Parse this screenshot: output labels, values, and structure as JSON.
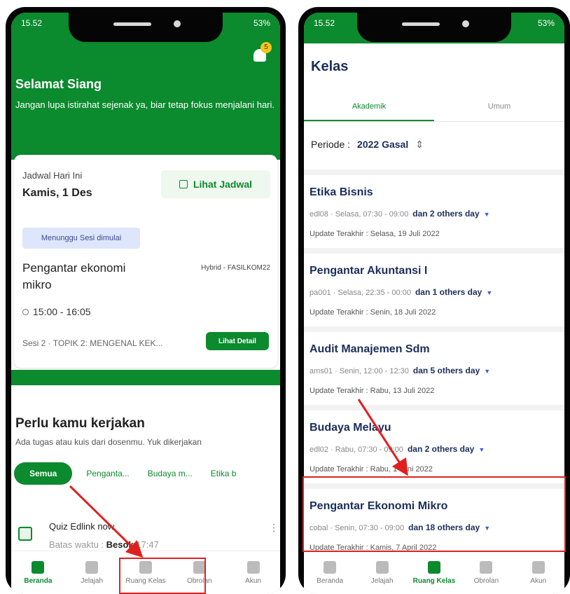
{
  "left": {
    "status": {
      "time": "15.52",
      "battery": "53%"
    },
    "notif_count": "5",
    "greeting": {
      "title": "Selamat Siang",
      "subtitle": "Jangan lupa istirahat sejenak ya, biar tetap fokus menjalani hari."
    },
    "schedule": {
      "label": "Jadwal Hari Ini",
      "date": "Kamis, 1 Des",
      "view_button": "Lihat Jadwal",
      "status_badge": "Menunggu Sesi dimulai",
      "course": "Pengantar ekonomi mikro",
      "mode": "Hybrid - FASILKOM22",
      "time": "15:00 - 16:05",
      "session": "Sesi 2 · TOPIK 2: MENGENAL KEK...",
      "detail_button": "Lihat Detail"
    },
    "todo": {
      "title": "Perlu kamu kerjakan",
      "subtitle": "Ada tugas atau kuis dari dosenmu. Yuk dikerjakan",
      "chips": [
        "Semua",
        "Penganta...",
        "Budaya m...",
        "Etika b"
      ],
      "quiz_title": "Quiz Edlink now",
      "deadline_label": "Batas waktu :",
      "deadline_day": "Besok",
      "deadline_time": "17:47"
    },
    "nav": [
      "Beranda",
      "Jelajah",
      "Ruang Kelas",
      "Obrolan",
      "Akun"
    ]
  },
  "right": {
    "status": {
      "time": "15.52",
      "battery": "53%"
    },
    "title": "Kelas",
    "tabs": [
      "Akademik",
      "Umum"
    ],
    "periode_label": "Periode :",
    "periode_value": "2022 Gasal",
    "courses": [
      {
        "name": "Etika Bisnis",
        "meta": "edl08 · Selasa, 07:30 - 09:00",
        "more": "dan 2 others day",
        "update": "Update Terakhir : Selasa, 19 Juli 2022"
      },
      {
        "name": "Pengantar Akuntansi I",
        "meta": "pa001 · Selasa, 22:35 - 00:00",
        "more": "dan 1 others day",
        "update": "Update Terakhir : Senin, 18 Juli 2022"
      },
      {
        "name": "Audit Manajemen Sdm",
        "meta": "ams01 · Senin, 12:00 - 12:30",
        "more": "dan 5 others day",
        "update": "Update Terakhir : Rabu, 13 Juli 2022"
      },
      {
        "name": "Budaya Melayu",
        "meta": "edl02 · Rabu, 07:30 - 09:00",
        "more": "dan 2 others day",
        "update": "Update Terakhir : Rabu, 1 Juni 2022"
      },
      {
        "name": "Pengantar Ekonomi Mikro",
        "meta": "cobal · Senin, 07:30 - 09:00",
        "more": "dan 18 others day",
        "update": "Update Terakhir : Kamis, 7 April 2022"
      }
    ],
    "nav": [
      "Beranda",
      "Jelajah",
      "Ruang Kelas",
      "Obrolan",
      "Akun"
    ]
  },
  "colors": {
    "brand_green": "#0b8a2e",
    "highlight_red": "#e02020",
    "title_navy": "#1b2d5a"
  }
}
